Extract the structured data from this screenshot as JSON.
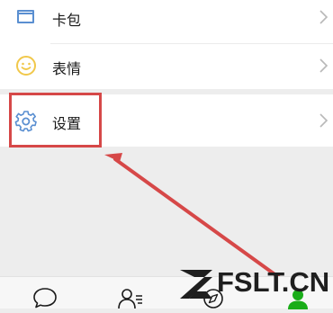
{
  "menu": {
    "card": {
      "label": "卡包"
    },
    "sticker": {
      "label": "表情"
    },
    "settings": {
      "label": "设置"
    }
  },
  "tabs": [
    "chats",
    "contacts",
    "discover",
    "me"
  ],
  "watermark": {
    "text": "FSLT.CN"
  },
  "colors": {
    "background": "#ededed",
    "accent_blue": "#5a8fd1",
    "sticker_yellow": "#f1c84b",
    "highlight_red": "#d64848",
    "me_tab_green": "#1aad19"
  }
}
